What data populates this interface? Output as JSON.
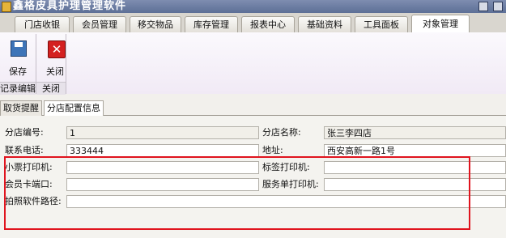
{
  "window": {
    "title": "鑫格皮具护理管理软件"
  },
  "ribbon": {
    "tabs": [
      "门店收银",
      "会员管理",
      "移交物品",
      "库存管理",
      "报表中心",
      "基础资料",
      "工具面板",
      "对象管理"
    ],
    "active_tab": "对象管理",
    "buttons": {
      "save": "保存",
      "close": "关闭"
    },
    "groups": {
      "record_edit": "记录编辑",
      "close": "关闭"
    }
  },
  "doc_tabs": [
    "取货提醒",
    "分店配置信息"
  ],
  "form": {
    "branch_no": {
      "label": "分店编号:",
      "value": "1"
    },
    "branch_name": {
      "label": "分店名称:",
      "value": "张三李四店"
    },
    "phone": {
      "label": "联系电话:",
      "value": "333444"
    },
    "address": {
      "label": "地址:",
      "value": "西安高新一路1号"
    },
    "receipt_printer": {
      "label": "小票打印机:",
      "value": ""
    },
    "label_printer": {
      "label": "标签打印机:",
      "value": ""
    },
    "member_card_port": {
      "label": "会员卡端口:",
      "value": ""
    },
    "service_printer": {
      "label": "服务单打印机:",
      "value": ""
    },
    "photo_path": {
      "label": "拍照软件路径:",
      "value": ""
    }
  },
  "colors": {
    "highlight_border": "#e0141e"
  }
}
